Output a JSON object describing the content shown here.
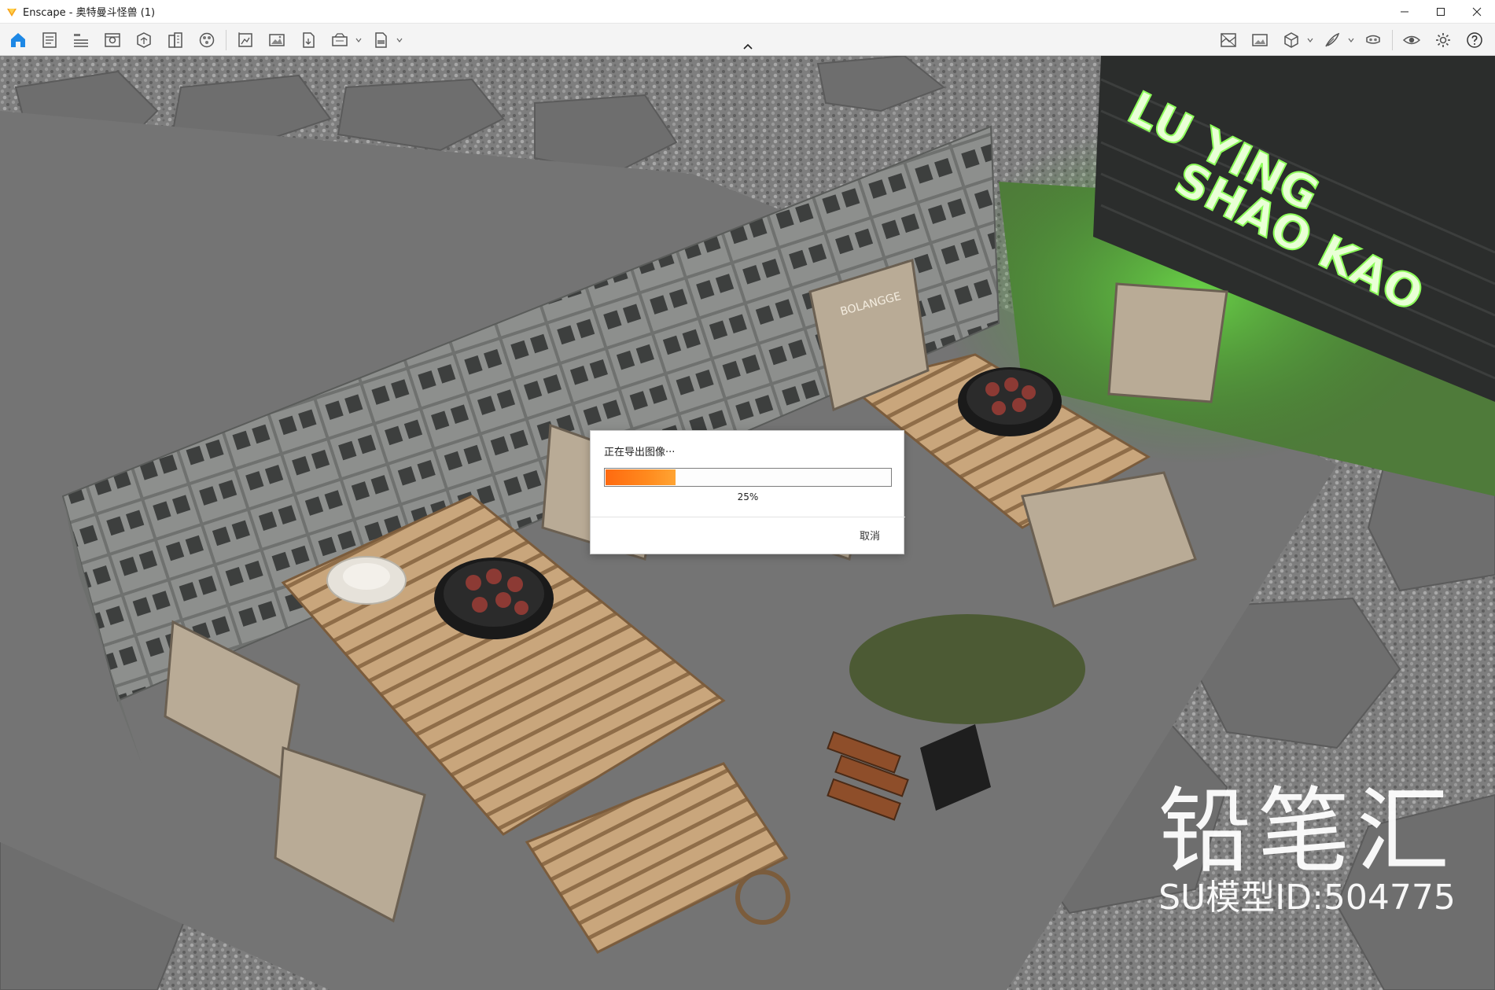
{
  "window": {
    "app_name": "Enscape",
    "separator": " - ",
    "document": "奥特曼斗怪兽 (1)"
  },
  "toolbar": {
    "left_buttons": [
      "home-icon",
      "document-icon",
      "bim-icon",
      "view-icon",
      "asset-library-icon",
      "building-icon",
      "material-icon",
      "views-manager-icon",
      "screenshot-icon",
      "export-icon",
      "batch-render-icon",
      "exe-export-icon"
    ],
    "right_buttons": [
      "atmosphere-icon",
      "image-settings-icon",
      "cube-icon",
      "feather-icon",
      "vr-headset-icon",
      "eye-icon",
      "gear-icon",
      "help-icon"
    ]
  },
  "dialog": {
    "message": "正在导出图像···",
    "progress": 0.25,
    "progress_text": "25%",
    "cancel_label": "取消"
  },
  "scene": {
    "sign_line1": "LU YING",
    "sign_line2": "SHAO KAO",
    "chair_brand": "BOLANGGE"
  },
  "watermark": {
    "brand": "铅笔汇",
    "model_id": "SU模型ID:504775"
  },
  "colors": {
    "accent": "#1e88e5",
    "progress": "#ff7a18",
    "sign_glow": "#8dff5a"
  }
}
